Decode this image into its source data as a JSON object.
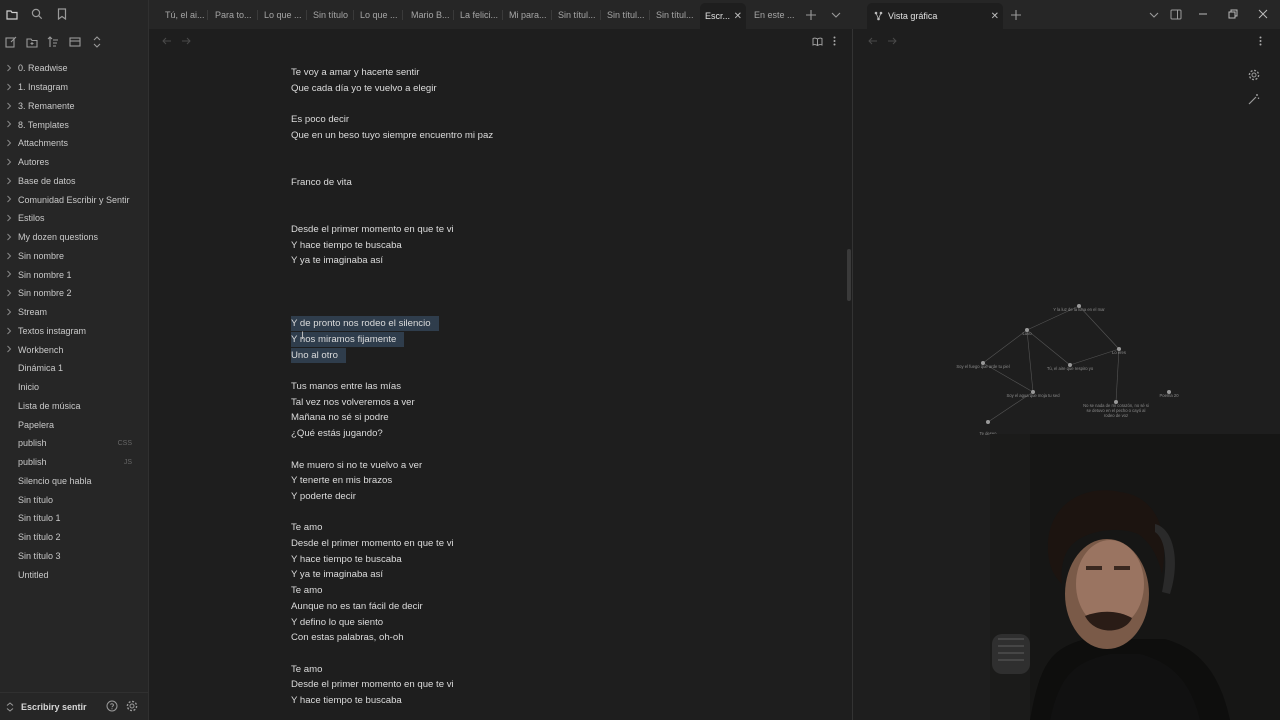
{
  "sidebar": {
    "tree": [
      {
        "label": "0. Readwise",
        "folder": true,
        "ext": ""
      },
      {
        "label": "1. Instagram",
        "folder": true,
        "ext": ""
      },
      {
        "label": "3. Remanente",
        "folder": true,
        "ext": ""
      },
      {
        "label": "8. Templates",
        "folder": true,
        "ext": ""
      },
      {
        "label": "Attachments",
        "folder": true,
        "ext": ""
      },
      {
        "label": "Autores",
        "folder": true,
        "ext": ""
      },
      {
        "label": "Base de datos",
        "folder": true,
        "ext": ""
      },
      {
        "label": "Comunidad Escribir y Sentir",
        "folder": true,
        "ext": ""
      },
      {
        "label": "Estilos",
        "folder": true,
        "ext": ""
      },
      {
        "label": "My dozen questions",
        "folder": true,
        "ext": ""
      },
      {
        "label": "Sin nombre",
        "folder": true,
        "ext": ""
      },
      {
        "label": "Sin nombre 1",
        "folder": true,
        "ext": ""
      },
      {
        "label": "Sin nombre 2",
        "folder": true,
        "ext": ""
      },
      {
        "label": "Stream",
        "folder": true,
        "ext": ""
      },
      {
        "label": "Textos instagram",
        "folder": true,
        "ext": ""
      },
      {
        "label": "Workbench",
        "folder": true,
        "ext": ""
      },
      {
        "label": "Dinámica 1",
        "folder": false,
        "ext": ""
      },
      {
        "label": "Inicio",
        "folder": false,
        "ext": ""
      },
      {
        "label": "Lista de música",
        "folder": false,
        "ext": ""
      },
      {
        "label": "Papelera",
        "folder": false,
        "ext": ""
      },
      {
        "label": "publish",
        "folder": false,
        "ext": "CSS"
      },
      {
        "label": "publish",
        "folder": false,
        "ext": "JS"
      },
      {
        "label": "Silencio que habla",
        "folder": false,
        "ext": ""
      },
      {
        "label": "Sin título",
        "folder": false,
        "ext": ""
      },
      {
        "label": "Sin título 1",
        "folder": false,
        "ext": ""
      },
      {
        "label": "Sin título 2",
        "folder": false,
        "ext": ""
      },
      {
        "label": "Sin título 3",
        "folder": false,
        "ext": ""
      },
      {
        "label": "Untitled",
        "folder": false,
        "ext": ""
      }
    ],
    "vault_name": "Escribiry sentir"
  },
  "tabs": [
    {
      "label": "Tú, el ai...",
      "active": false
    },
    {
      "label": "Para to...",
      "active": false
    },
    {
      "label": "Lo que ...",
      "active": false
    },
    {
      "label": "Sin título",
      "active": false
    },
    {
      "label": "Lo que ...",
      "active": false
    },
    {
      "label": "Mario B...",
      "active": false
    },
    {
      "label": "La felici...",
      "active": false
    },
    {
      "label": "Mi para...",
      "active": false
    },
    {
      "label": "Sin títul...",
      "active": false
    },
    {
      "label": "Sin títul...",
      "active": false
    },
    {
      "label": "Sin títul...",
      "active": false
    },
    {
      "label": "Escr...",
      "active": true
    },
    {
      "label": "En este ...",
      "active": false
    }
  ],
  "graph_tab": {
    "label": "Vista gráfica"
  },
  "editor": {
    "lines": [
      {
        "text": "Te voy a amar y hacerte sentir",
        "selected": false
      },
      {
        "text": "Que cada día yo te vuelvo a elegir",
        "selected": false
      },
      {
        "text": "",
        "selected": false
      },
      {
        "text": "Es poco decir",
        "selected": false
      },
      {
        "text": "Que en un beso tuyo siempre encuentro mi paz",
        "selected": false
      },
      {
        "text": "",
        "selected": false
      },
      {
        "text": "",
        "selected": false
      },
      {
        "text": "Franco de vita",
        "selected": false
      },
      {
        "text": "",
        "selected": false
      },
      {
        "text": "",
        "selected": false
      },
      {
        "text": "Desde el primer momento en que te vi",
        "selected": false
      },
      {
        "text": "Y hace tiempo te buscaba",
        "selected": false
      },
      {
        "text": "Y ya te imaginaba así",
        "selected": false
      },
      {
        "text": "",
        "selected": false
      },
      {
        "text": "",
        "selected": false
      },
      {
        "text": "",
        "selected": false
      },
      {
        "text": "Y de pronto nos rodeo el silencio",
        "selected": true
      },
      {
        "text": "Y nos miramos fijamente",
        "selected": true
      },
      {
        "text": "Uno al otro",
        "selected": true
      },
      {
        "text": "",
        "selected": false
      },
      {
        "text": "Tus manos entre las mías",
        "selected": false
      },
      {
        "text": "Tal vez nos volveremos a ver",
        "selected": false
      },
      {
        "text": "Mañana no sé si podre",
        "selected": false
      },
      {
        "text": "¿Qué estás jugando?",
        "selected": false
      },
      {
        "text": "",
        "selected": false
      },
      {
        "text": "Me muero si no te vuelvo a ver",
        "selected": false
      },
      {
        "text": "Y tenerte en mis brazos",
        "selected": false
      },
      {
        "text": "Y poderte decir",
        "selected": false
      },
      {
        "text": "",
        "selected": false
      },
      {
        "text": "Te amo",
        "selected": false
      },
      {
        "text": "Desde el primer momento en que te vi",
        "selected": false
      },
      {
        "text": "Y hace tiempo te buscaba",
        "selected": false
      },
      {
        "text": "Y ya te imaginaba así",
        "selected": false
      },
      {
        "text": "Te amo",
        "selected": false
      },
      {
        "text": "Aunque no es tan fácil de decir",
        "selected": false
      },
      {
        "text": "Y defino lo que siento",
        "selected": false
      },
      {
        "text": "Con estas palabras, oh-oh",
        "selected": false
      },
      {
        "text": "",
        "selected": false
      },
      {
        "text": "Te amo",
        "selected": false
      },
      {
        "text": "Desde el primer momento en que te vi",
        "selected": false
      },
      {
        "text": "Y hace tiempo te buscaba",
        "selected": false
      }
    ]
  },
  "graph": {
    "nodes": [
      {
        "label": "Y la luz de la luna en el mar"
      },
      {
        "label": "Luvo"
      },
      {
        "label": "Lo eres"
      },
      {
        "label": "Soy el fuego que arde tu piel"
      },
      {
        "label": "Tú, el aire que respiro yo"
      },
      {
        "label": "Soy el agua que moja tu sed"
      },
      {
        "label": "Poema 20"
      },
      {
        "label": "No se nada de mí corazón, no sé si se detuvo en el pecho o cayó al rodeo de voz"
      },
      {
        "label": "Te deseo"
      }
    ]
  },
  "colors": {
    "selection": "#2f3d4c",
    "background": "#1e1e1e",
    "sidebar": "#262626"
  }
}
